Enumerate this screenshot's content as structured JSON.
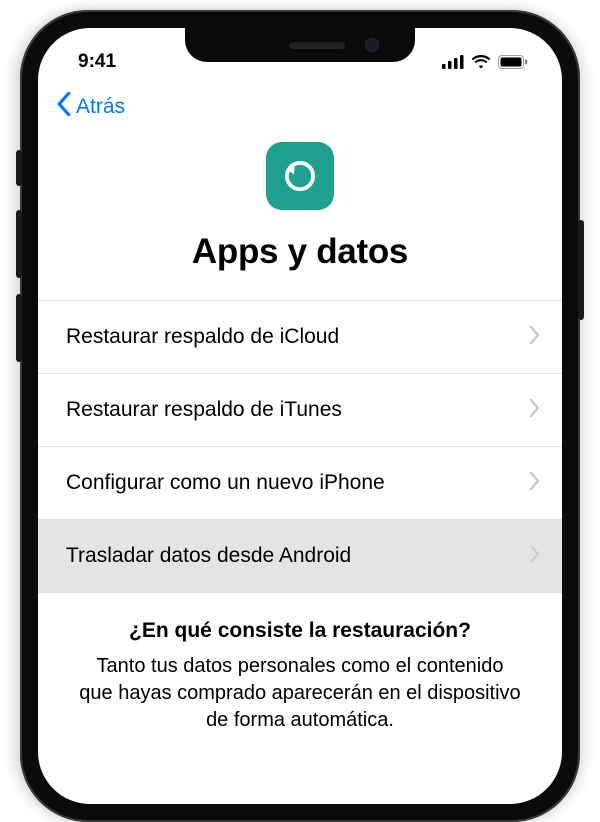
{
  "status": {
    "time": "9:41"
  },
  "nav": {
    "back_label": "Atrás"
  },
  "hero": {
    "title": "Apps y datos"
  },
  "menu": {
    "items": [
      {
        "label": "Restaurar respaldo de iCloud",
        "selected": false
      },
      {
        "label": "Restaurar respaldo de iTunes",
        "selected": false
      },
      {
        "label": "Configurar como un nuevo iPhone",
        "selected": false
      },
      {
        "label": "Trasladar datos desde Android",
        "selected": true
      }
    ]
  },
  "info": {
    "title": "¿En qué consiste la restauración?",
    "text": "Tanto tus datos personales como el contenido que hayas comprado aparecerán en el dispositivo de forma automática."
  }
}
